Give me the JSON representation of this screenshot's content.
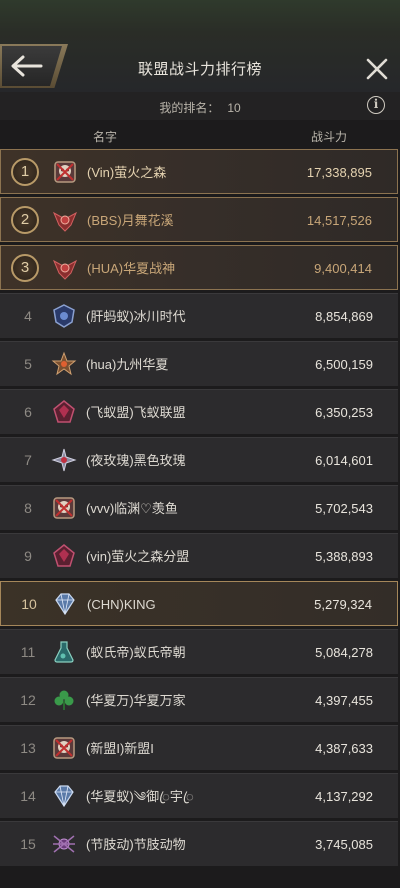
{
  "header": {
    "title": "联盟战斗力排行榜",
    "back_icon": "back-arrow-icon",
    "close_icon": "close-icon"
  },
  "my_rank": {
    "label": "我的排名：",
    "value": "10"
  },
  "columns": {
    "name": "名字",
    "power": "战斗力"
  },
  "colors": {
    "gold_border": "#8c7350",
    "highlight_border": "#a5875a",
    "row_bg": "#2c2b2d"
  },
  "rows": [
    {
      "rank": "1",
      "name": "(Vin)萤火之森",
      "power": "17,338,895",
      "emblem": "red-skull-emblem"
    },
    {
      "rank": "2",
      "name": "(BBS)月舞花溪",
      "power": "14,517,526",
      "emblem": "red-wings-emblem"
    },
    {
      "rank": "3",
      "name": "(HUA)华夏战神",
      "power": "9,400,414",
      "emblem": "red-wings-emblem"
    },
    {
      "rank": "4",
      "name": "(肝蚂蚁)冰川时代",
      "power": "8,854,869",
      "emblem": "blue-shield-emblem"
    },
    {
      "rank": "5",
      "name": "(hua)九州华夏",
      "power": "6,500,159",
      "emblem": "bronze-star-emblem"
    },
    {
      "rank": "6",
      "name": "(飞蚁盟)飞蚁联盟",
      "power": "6,350,253",
      "emblem": "crimson-gem-emblem"
    },
    {
      "rank": "7",
      "name": "(夜玫瑰)黑色玫瑰",
      "power": "6,014,601",
      "emblem": "silver-star-emblem"
    },
    {
      "rank": "8",
      "name": "(vvv)临渊♡羡鱼",
      "power": "5,702,543",
      "emblem": "red-skull-emblem"
    },
    {
      "rank": "9",
      "name": "(vin)萤火之森分盟",
      "power": "5,388,893",
      "emblem": "crimson-gem-emblem"
    },
    {
      "rank": "10",
      "name": "(CHN)KING",
      "power": "5,279,324",
      "emblem": "diamond-emblem"
    },
    {
      "rank": "11",
      "name": "(蚁氏帝)蚁氏帝朝",
      "power": "5,084,278",
      "emblem": "teal-flask-emblem"
    },
    {
      "rank": "12",
      "name": "(华夏万)华夏万家",
      "power": "4,397,455",
      "emblem": "clover-emblem"
    },
    {
      "rank": "13",
      "name": "(新盟I)新盟I",
      "power": "4,387,633",
      "emblem": "red-skull-emblem"
    },
    {
      "rank": "14",
      "name": "(华夏蚁)༄御ꦿ宇ꦿ",
      "power": "4,137,292",
      "emblem": "diamond-emblem"
    },
    {
      "rank": "15",
      "name": "(节肢动)节肢动物",
      "power": "3,745,085",
      "emblem": "purple-spider-emblem"
    }
  ]
}
